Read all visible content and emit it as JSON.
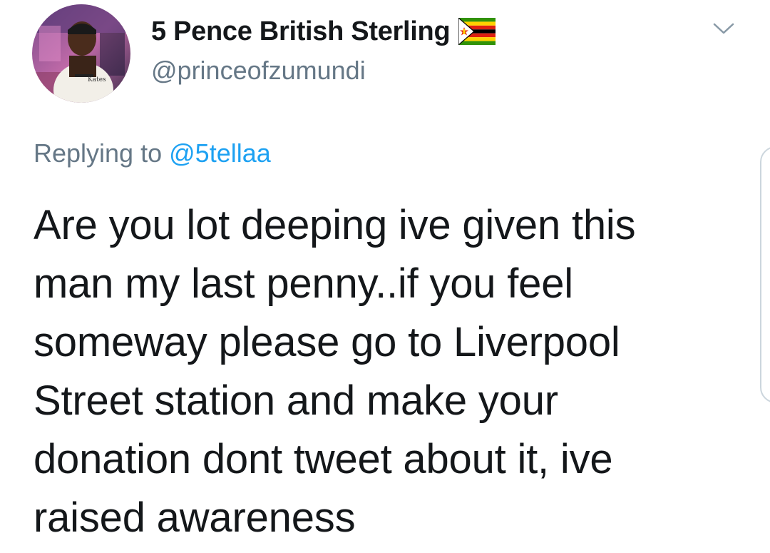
{
  "tweet": {
    "author": {
      "display_name": "5 Pence British Sterling",
      "username": "@princeofzumundi",
      "avatar_icon": "profile-photo",
      "name_emoji_icon": "zimbabwe-flag-icon"
    },
    "menu_icon": "chevron-down-icon",
    "reply_context": {
      "prefix": "Replying to",
      "mention": "@5tellaa"
    },
    "text_lines": [
      "Are you lot deeping ive given this",
      "man my last penny..if you feel",
      "someway please go to Liverpool",
      "Street station and make your",
      "donation dont tweet about it, ive",
      "raised awareness"
    ]
  },
  "colors": {
    "primary_text": "#14171a",
    "secondary_text": "#657786",
    "link": "#1da1f2",
    "border": "#ccd6dd"
  }
}
